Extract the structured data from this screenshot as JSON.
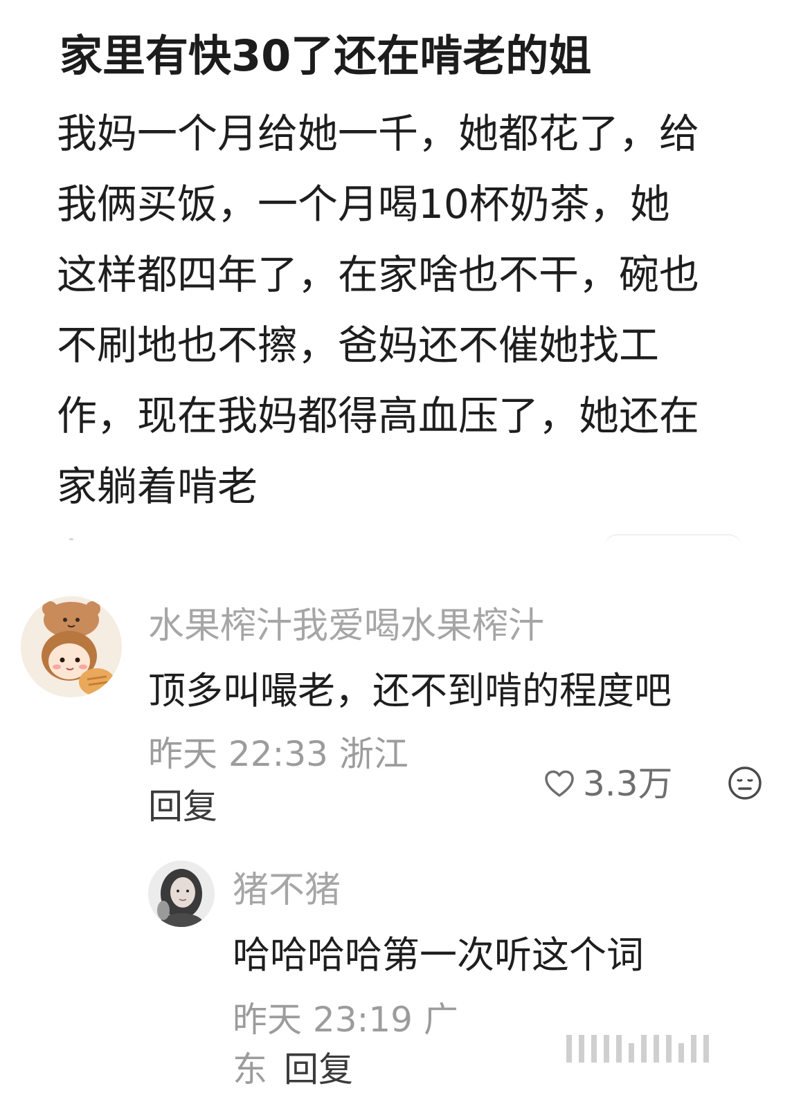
{
  "post": {
    "title": "家里有快30了还在啃老的姐",
    "body_lines": [
      "我妈一个月给她一千，她都花了，给",
      "我俩买饭，一个月喝10杯奶茶，她",
      "这样都四年了，在家啥也不干，碗也",
      "不刷地也不擦，爸妈还不催她找工",
      "作，现在我妈都得高血压了，她还在",
      "家躺着啃老"
    ]
  },
  "comment": {
    "username": "水果榨汁我爱喝水果榨汁",
    "text": "顶多叫嘬老，还不到啃的程度吧",
    "meta": "昨天 22:33 浙江",
    "reply_label": "回复",
    "like_count": "3.3万",
    "icons": {
      "avatar": "cartoon-girl-avatar",
      "like": "heart-outline-icon",
      "reaction": "meh-face-icon"
    },
    "colors": {
      "username": "#a6a6a6",
      "meta": "#9c9c9c",
      "text": "#1e1e1e"
    }
  },
  "reply": {
    "username": "猪不猪",
    "text": "哈哈哈哈第一次听这个词",
    "meta_line1": "昨天 23:19 广",
    "meta_line2": "东",
    "reply_label": "回复",
    "icons": {
      "avatar": "woman-portrait-avatar"
    }
  }
}
